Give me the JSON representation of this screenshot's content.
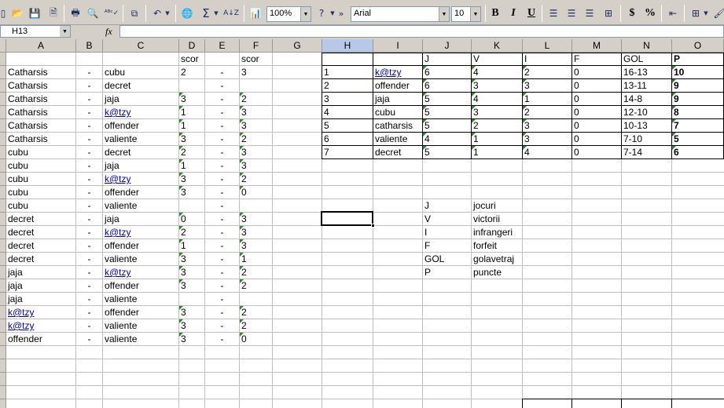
{
  "toolbar": {
    "zoom": "100%",
    "font": "Arial",
    "font_size": "10",
    "bold": "B",
    "italic": "I",
    "underline": "U",
    "currency": "$",
    "percent": "%"
  },
  "formula_bar": {
    "cell_ref": "H13",
    "fx": "fx",
    "value": ""
  },
  "grid": {
    "columns": [
      "A",
      "B",
      "C",
      "D",
      "E",
      "F",
      "G",
      "H",
      "I",
      "J",
      "K",
      "L",
      "M",
      "N",
      "O"
    ],
    "selected_column": "H",
    "header_row": {
      "d": "scor",
      "f": "scor"
    },
    "matches": [
      {
        "a": "Catharsis",
        "b": "-",
        "c": "cubu",
        "d": "2",
        "e": "-",
        "f": "3"
      },
      {
        "a": "Catharsis",
        "b": "-",
        "c": "decret",
        "d": "",
        "e": "-",
        "f": ""
      },
      {
        "a": "Catharsis",
        "b": "-",
        "c": "jaja",
        "d": "3",
        "e": "-",
        "f": "2"
      },
      {
        "a": "Catharsis",
        "b": "-",
        "c": "k@tzy",
        "d": "1",
        "e": "-",
        "f": "3"
      },
      {
        "a": "Catharsis",
        "b": "-",
        "c": "offender",
        "d": "1",
        "e": "-",
        "f": "3"
      },
      {
        "a": "Catharsis",
        "b": "-",
        "c": "valiente",
        "d": "3",
        "e": "-",
        "f": "2"
      },
      {
        "a": "cubu",
        "b": "-",
        "c": "decret",
        "d": "2",
        "e": "-",
        "f": "3"
      },
      {
        "a": "cubu",
        "b": "-",
        "c": "jaja",
        "d": "1",
        "e": "-",
        "f": "3"
      },
      {
        "a": "cubu",
        "b": "-",
        "c": "k@tzy",
        "d": "3",
        "e": "-",
        "f": "2"
      },
      {
        "a": "cubu",
        "b": "-",
        "c": "offender",
        "d": "3",
        "e": "-",
        "f": "0"
      },
      {
        "a": "cubu",
        "b": "-",
        "c": "valiente",
        "d": "",
        "e": "-",
        "f": ""
      },
      {
        "a": "decret",
        "b": "-",
        "c": "jaja",
        "d": "0",
        "e": "-",
        "f": "3"
      },
      {
        "a": "decret",
        "b": "-",
        "c": "k@tzy",
        "d": "2",
        "e": "-",
        "f": "3"
      },
      {
        "a": "decret",
        "b": "-",
        "c": "offender",
        "d": "1",
        "e": "-",
        "f": "3"
      },
      {
        "a": "decret",
        "b": "-",
        "c": "valiente",
        "d": "3",
        "e": "-",
        "f": "1"
      },
      {
        "a": "jaja",
        "b": "-",
        "c": "k@tzy",
        "d": "3",
        "e": "-",
        "f": "2"
      },
      {
        "a": "jaja",
        "b": "-",
        "c": "offender",
        "d": "3",
        "e": "-",
        "f": "2"
      },
      {
        "a": "jaja",
        "b": "-",
        "c": "valiente",
        "d": "",
        "e": "-",
        "f": ""
      },
      {
        "a": "k@tzy",
        "b": "-",
        "c": "offender",
        "d": "3",
        "e": "-",
        "f": "2"
      },
      {
        "a": "k@tzy",
        "b": "-",
        "c": "valiente",
        "d": "3",
        "e": "-",
        "f": "2"
      },
      {
        "a": "offender",
        "b": "-",
        "c": "valiente",
        "d": "3",
        "e": "-",
        "f": "0"
      }
    ],
    "standings_headers": {
      "h": "",
      "i": "",
      "j": "J",
      "k": "V",
      "l": "I",
      "m": "F",
      "n": "GOL",
      "o": "P"
    },
    "standings": [
      {
        "pos": "1",
        "team": "k@tzy",
        "j": "6",
        "v": "4",
        "i": "2",
        "f": "0",
        "gol": "16-13",
        "p": "10"
      },
      {
        "pos": "2",
        "team": "offender",
        "j": "6",
        "v": "3",
        "i": "3",
        "f": "0",
        "gol": "13-11",
        "p": "9"
      },
      {
        "pos": "3",
        "team": "jaja",
        "j": "5",
        "v": "4",
        "i": "1",
        "f": "0",
        "gol": "14-8",
        "p": "9"
      },
      {
        "pos": "4",
        "team": "cubu",
        "j": "5",
        "v": "3",
        "i": "2",
        "f": "0",
        "gol": "12-10",
        "p": "8"
      },
      {
        "pos": "5",
        "team": "catharsis",
        "j": "5",
        "v": "2",
        "i": "3",
        "f": "0",
        "gol": "10-13",
        "p": "7"
      },
      {
        "pos": "6",
        "team": "valiente",
        "j": "4",
        "v": "1",
        "i": "3",
        "f": "0",
        "gol": "7-10",
        "p": "5"
      },
      {
        "pos": "7",
        "team": "decret",
        "j": "5",
        "v": "1",
        "i": "4",
        "f": "0",
        "gol": "7-14",
        "p": "6"
      }
    ],
    "legend": [
      {
        "abbr": "J",
        "desc": "jocuri"
      },
      {
        "abbr": "V",
        "desc": "victorii"
      },
      {
        "abbr": "I",
        "desc": "infrangeri"
      },
      {
        "abbr": "F",
        "desc": "forfeit"
      },
      {
        "abbr": "GOL",
        "desc": "golavetraj"
      },
      {
        "abbr": "P",
        "desc": "puncte"
      }
    ]
  }
}
